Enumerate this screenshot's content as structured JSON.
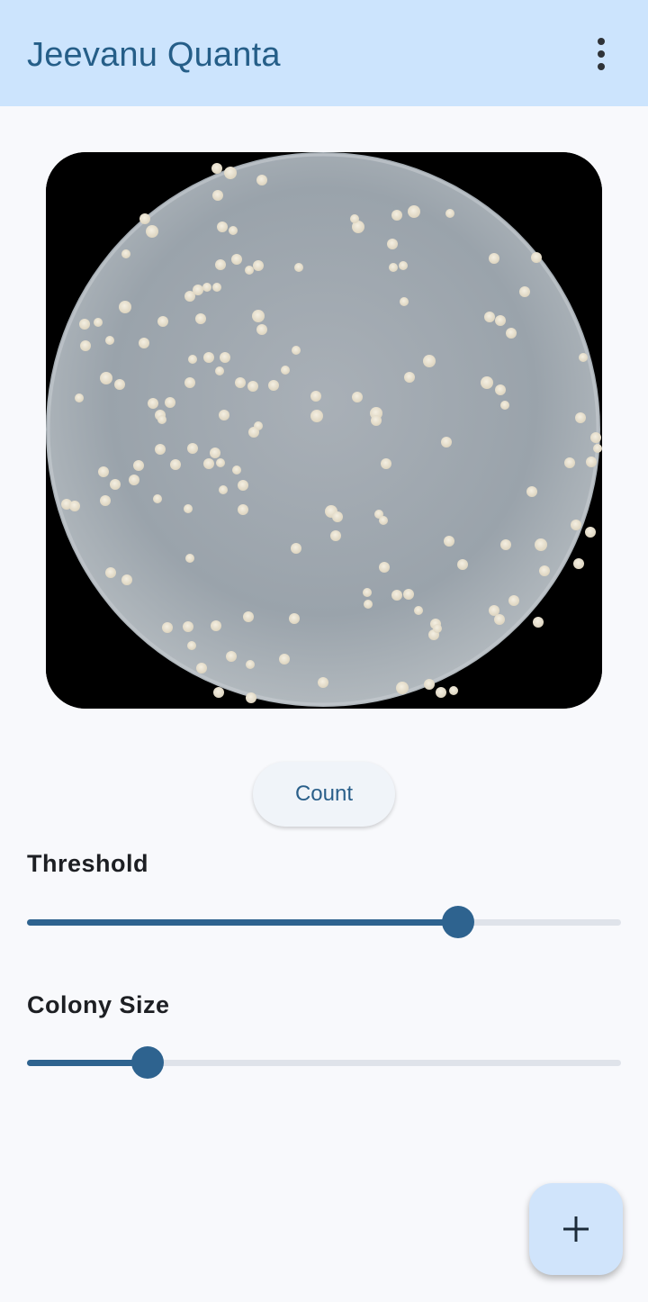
{
  "app_bar": {
    "title": "Jeevanu Quanta",
    "menu_icon": "more-vert-icon"
  },
  "image": {
    "subject": "petri-dish-colonies-photo"
  },
  "actions": {
    "count_label": "Count"
  },
  "threshold": {
    "label": "Threshold",
    "value_fraction": 0.725
  },
  "colony_size": {
    "label": "Colony Size",
    "value_fraction": 0.203
  },
  "fab": {
    "icon": "add-icon"
  },
  "colors": {
    "app_bar_bg": "#cce4fd",
    "accent": "#2e638f",
    "fab_bg": "#d0e4fb"
  }
}
